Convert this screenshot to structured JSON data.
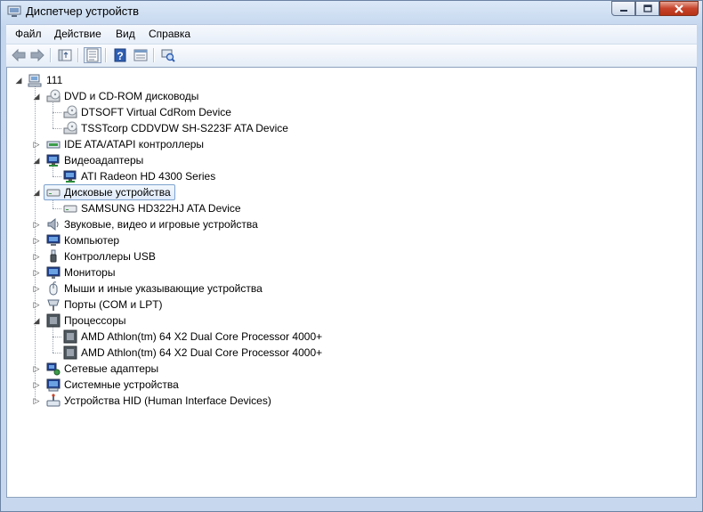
{
  "window": {
    "title": "Диспетчер устройств",
    "controls": [
      "minimize",
      "maximize",
      "close"
    ]
  },
  "menu": [
    "Файл",
    "Действие",
    "Вид",
    "Справка"
  ],
  "toolbar": {
    "buttons": [
      "back-icon",
      "forward-icon",
      "up-icon",
      "properties-icon",
      "help-icon",
      "view-icon",
      "scan-hardware-icon"
    ]
  },
  "tree": {
    "root": "111",
    "nodes": [
      {
        "label": "DVD и CD-ROM дисководы",
        "icon": "dvd-drive-icon",
        "expanded": true,
        "children": [
          "DTSOFT Virtual CdRom Device",
          "TSSTcorp CDDVDW SH-S223F ATA Device"
        ]
      },
      {
        "label": "IDE ATA/ATAPI контроллеры",
        "icon": "ide-controller-icon",
        "expanded": false
      },
      {
        "label": "Видеоадаптеры",
        "icon": "display-adapter-icon",
        "expanded": true,
        "children": [
          "ATI Radeon HD 4300 Series"
        ]
      },
      {
        "label": "Дисковые устройства",
        "icon": "disk-drive-icon",
        "expanded": true,
        "selected": true,
        "children": [
          "SAMSUNG HD322HJ ATA Device"
        ]
      },
      {
        "label": "Звуковые, видео и игровые устройства",
        "icon": "sound-icon",
        "expanded": false
      },
      {
        "label": "Компьютер",
        "icon": "computer-icon",
        "expanded": false
      },
      {
        "label": "Контроллеры USB",
        "icon": "usb-icon",
        "expanded": false
      },
      {
        "label": "Мониторы",
        "icon": "monitor-icon",
        "expanded": false
      },
      {
        "label": "Мыши и иные указывающие устройства",
        "icon": "mouse-icon",
        "expanded": false
      },
      {
        "label": "Порты (COM и LPT)",
        "icon": "port-icon",
        "expanded": false
      },
      {
        "label": "Процессоры",
        "icon": "processor-icon",
        "expanded": true,
        "children": [
          "AMD Athlon(tm) 64 X2 Dual Core Processor 4000+",
          "AMD Athlon(tm) 64 X2 Dual Core Processor 4000+"
        ]
      },
      {
        "label": "Сетевые адаптеры",
        "icon": "network-adapter-icon",
        "expanded": false
      },
      {
        "label": "Системные устройства",
        "icon": "system-devices-icon",
        "expanded": false
      },
      {
        "label": "Устройства HID (Human Interface Devices)",
        "icon": "hid-icon",
        "expanded": false
      }
    ]
  },
  "colors": {
    "selection_border": "#7da2ce",
    "window_frame": "#c4d6ee",
    "close_button": "#c7432b"
  }
}
